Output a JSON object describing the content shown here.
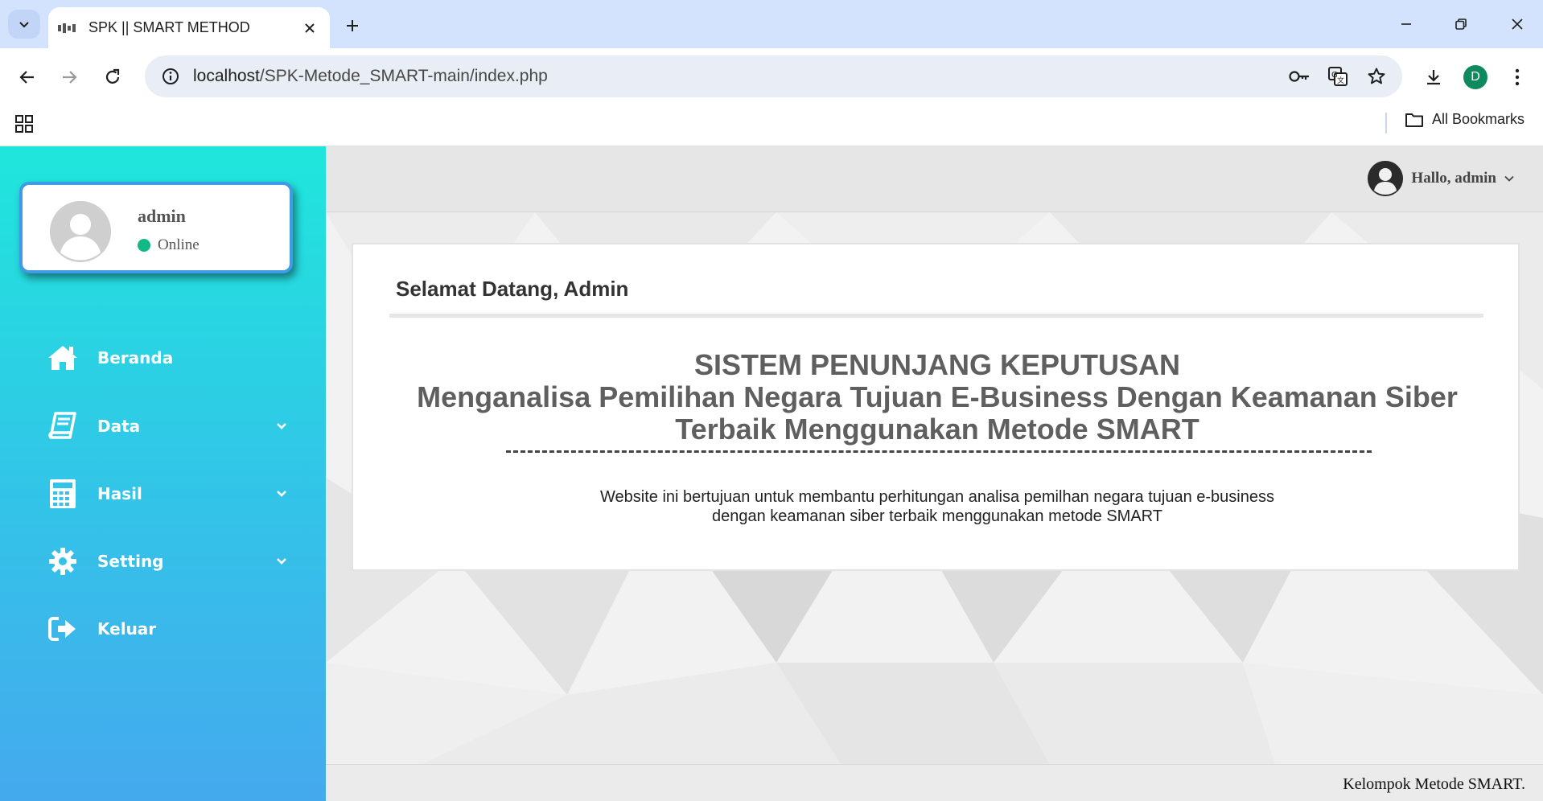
{
  "browser": {
    "tab_title": "SPK || SMART METHOD",
    "url_host": "localhost",
    "url_path": "/SPK-Metode_SMART-main/index.php",
    "bookmarks_label": "All Bookmarks",
    "profile_initial": "D"
  },
  "sidebar": {
    "user_name": "admin",
    "user_status": "Online",
    "items": [
      {
        "label": "Beranda",
        "icon": "home-icon"
      },
      {
        "label": "Data",
        "icon": "book-icon"
      },
      {
        "label": "Hasil",
        "icon": "calculator-icon"
      },
      {
        "label": "Setting",
        "icon": "gear-icon"
      },
      {
        "label": "Keluar",
        "icon": "logout-icon"
      }
    ]
  },
  "topbar": {
    "greeting": "Hallo, admin"
  },
  "card": {
    "title": "Selamat Datang, Admin",
    "headline_1": "SISTEM PENUNJANG KEPUTUSAN",
    "headline_2": "Menganalisa Pemilihan Negara Tujuan E-Business Dengan Keamanan Siber",
    "headline_3": "Terbaik Menggunakan Metode SMART",
    "desc_1": "Website ini bertujuan untuk membantu perhitungan analisa pemilhan negara tujuan e-business",
    "desc_2": "dengan keamanan siber terbaik menggunakan metode SMART"
  },
  "footer": {
    "text": "Kelompok Metode SMART."
  },
  "colors": {
    "sidebar_top": "#1fe6dc",
    "sidebar_bottom": "#45a9ee",
    "status_online": "#12b886",
    "card_border": "#3f9be6"
  }
}
